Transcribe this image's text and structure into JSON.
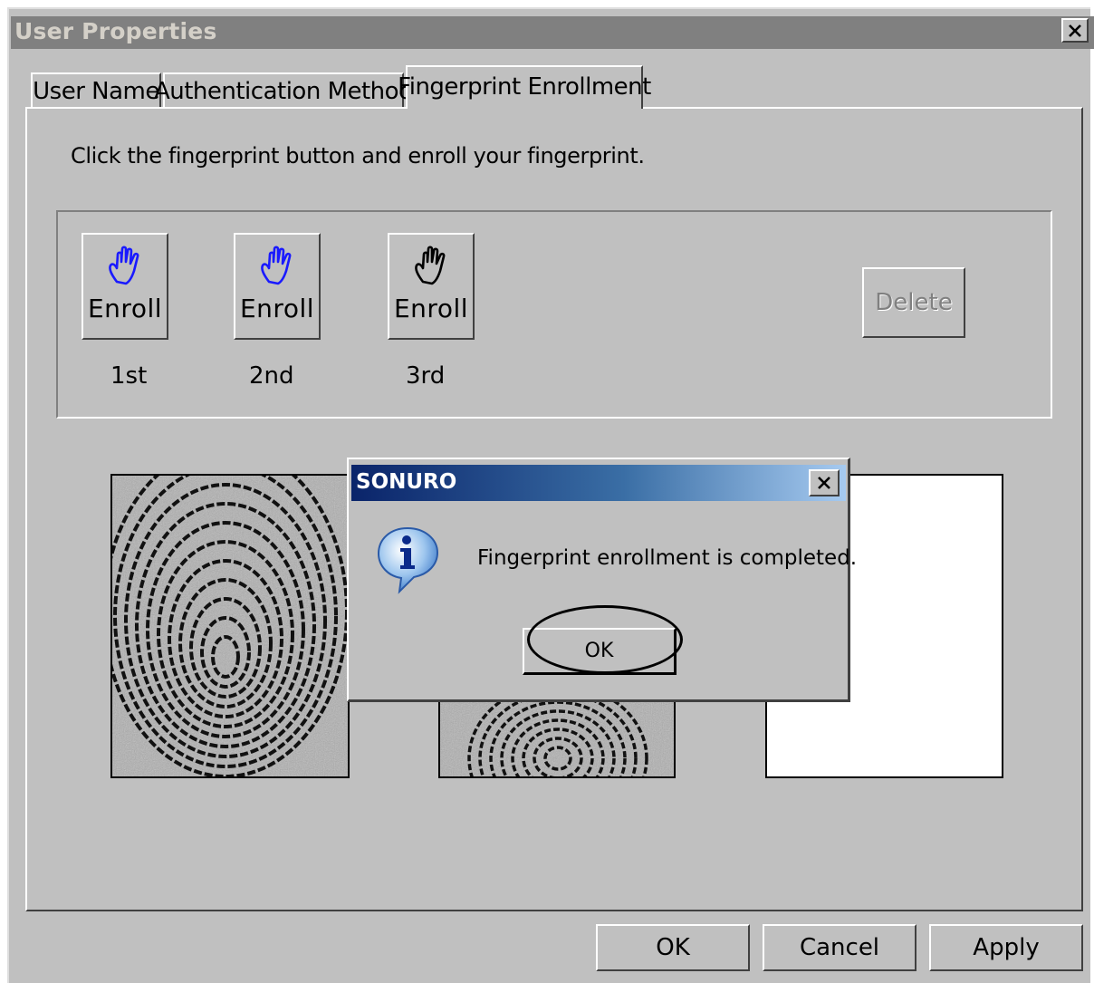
{
  "window": {
    "title": "User Properties",
    "close_label": "X"
  },
  "tabs": [
    {
      "label": "User Name",
      "active": false
    },
    {
      "label": "Authentication Method",
      "active": false
    },
    {
      "label": "Fingerprint Enrollment",
      "active": true
    }
  ],
  "panel": {
    "instruction": "Click the fingerprint button and enroll your fingerprint.",
    "enroll_buttons": [
      {
        "label": "Enroll",
        "ordinal": "1st",
        "icon": "hand-icon",
        "icon_color": "#1a1aff"
      },
      {
        "label": "Enroll",
        "ordinal": "2nd",
        "icon": "hand-icon",
        "icon_color": "#1a1aff"
      },
      {
        "label": "Enroll",
        "ordinal": "3rd",
        "icon": "hand-icon",
        "icon_color": "#000000"
      }
    ],
    "delete_label": "Delete"
  },
  "footer": {
    "ok_label": "OK",
    "cancel_label": "Cancel",
    "apply_label": "Apply"
  },
  "dialog": {
    "title": "SONURO",
    "message": "Fingerprint enrollment is completed.",
    "ok_label": "OK",
    "icon": "info-icon"
  },
  "colors": {
    "face": "#c0c0c0",
    "dialog_title_start": "#0a246a",
    "dialog_title_end": "#a6caf0"
  }
}
